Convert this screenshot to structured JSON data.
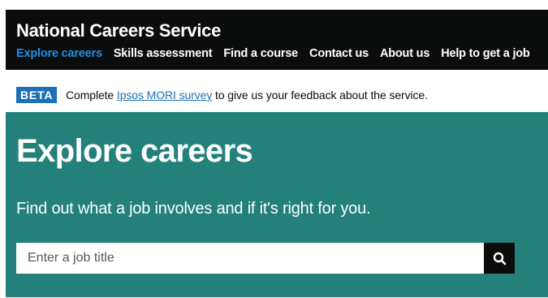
{
  "header": {
    "service_name": "National Careers Service",
    "nav": [
      {
        "label": "Explore careers",
        "active": true
      },
      {
        "label": "Skills assessment",
        "active": false
      },
      {
        "label": "Find a course",
        "active": false
      },
      {
        "label": "Contact us",
        "active": false
      },
      {
        "label": "About us",
        "active": false
      },
      {
        "label": "Help to get a job",
        "active": false
      }
    ]
  },
  "beta_banner": {
    "tag": "BETA",
    "text_before": "Complete ",
    "link_text": "Ipsos MORI survey",
    "text_after": " to give us your feedback about the service."
  },
  "hero": {
    "title": "Explore careers",
    "lead": "Find out what a job involves and if it's right for you.",
    "search": {
      "placeholder": "Enter a job title",
      "value": "",
      "button_icon": "search-icon"
    }
  },
  "colors": {
    "header_bg": "#0b0c0c",
    "nav_active": "#1d8feb",
    "beta_tag_bg": "#1d70b8",
    "link": "#1d70b8",
    "hero_bg": "#23807a",
    "search_button_bg": "#0b0c0c"
  }
}
